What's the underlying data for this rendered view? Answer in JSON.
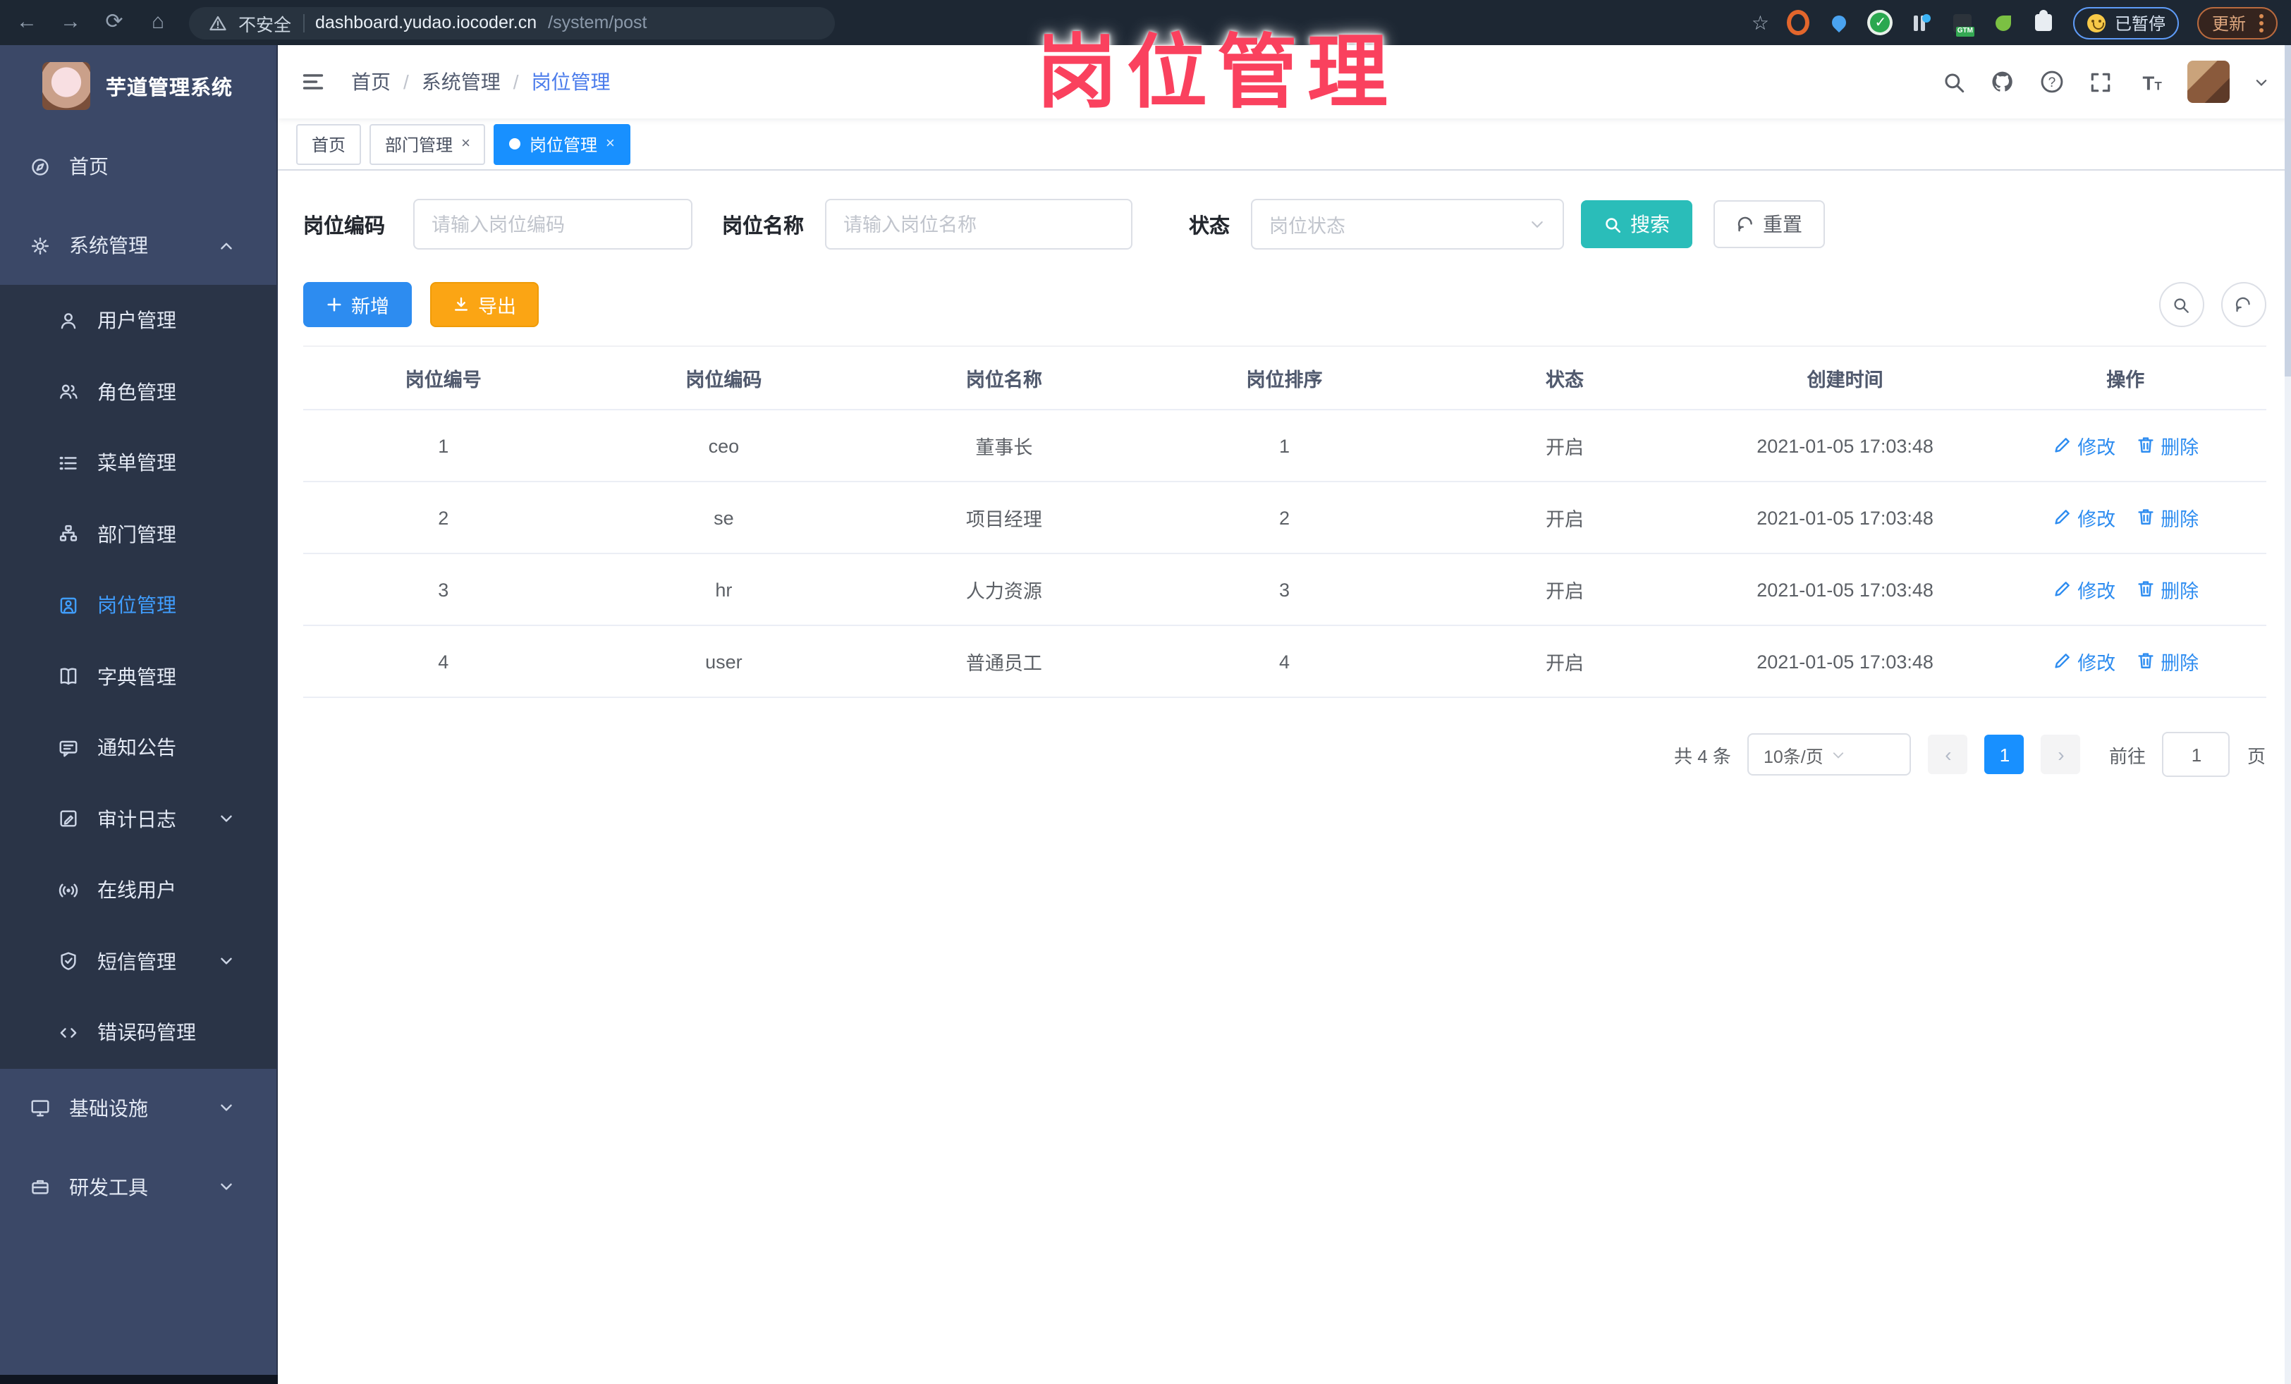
{
  "overlay": {
    "title": "岗位管理"
  },
  "browser": {
    "security_label": "不安全",
    "url_host": "dashboard.yudao.iocoder.cn",
    "url_path": "/system/post",
    "paused_label": "已暂停",
    "update_label": "更新"
  },
  "sidebar": {
    "logo_title": "芋道管理系统",
    "sections": [
      {
        "type": "item",
        "key": "home",
        "label": "首页",
        "icon": "compass"
      },
      {
        "type": "group",
        "key": "system-management",
        "label": "系统管理",
        "icon": "gear",
        "chevron": "up",
        "children": [
          {
            "key": "user-management",
            "label": "用户管理",
            "icon": "user"
          },
          {
            "key": "role-management",
            "label": "角色管理",
            "icon": "users"
          },
          {
            "key": "menu-management",
            "label": "菜单管理",
            "icon": "menulist"
          },
          {
            "key": "dept-management",
            "label": "部门管理",
            "icon": "orgtree"
          },
          {
            "key": "post-management",
            "label": "岗位管理",
            "icon": "badge",
            "active": true
          },
          {
            "key": "dict-management",
            "label": "字典管理",
            "icon": "book"
          },
          {
            "key": "notice",
            "label": "通知公告",
            "icon": "message"
          },
          {
            "key": "audit-log",
            "label": "审计日志",
            "icon": "log",
            "chevron": "down"
          },
          {
            "key": "online-user",
            "label": "在线用户",
            "icon": "broadcast"
          },
          {
            "key": "sms-management",
            "label": "短信管理",
            "icon": "shield",
            "chevron": "down"
          },
          {
            "key": "error-code",
            "label": "错误码管理",
            "icon": "code"
          }
        ]
      },
      {
        "type": "item",
        "key": "infrastructure",
        "label": "基础设施",
        "icon": "monitor",
        "chevron": "down"
      },
      {
        "type": "item",
        "key": "dev-tools",
        "label": "研发工具",
        "icon": "toolbox",
        "chevron": "down"
      }
    ]
  },
  "navbar": {
    "breadcrumb": [
      "首页",
      "系统管理",
      "岗位管理"
    ]
  },
  "tabs": [
    {
      "label": "首页",
      "closable": false,
      "active": false
    },
    {
      "label": "部门管理",
      "closable": true,
      "active": false
    },
    {
      "label": "岗位管理",
      "closable": true,
      "active": true
    }
  ],
  "filters": {
    "code_label": "岗位编码",
    "code_placeholder": "请输入岗位编码",
    "name_label": "岗位名称",
    "name_placeholder": "请输入岗位名称",
    "status_label": "状态",
    "status_placeholder": "岗位状态",
    "search_label": "搜索",
    "reset_label": "重置"
  },
  "toolbar": {
    "add_label": "新增",
    "export_label": "导出"
  },
  "table": {
    "columns": [
      "岗位编号",
      "岗位编码",
      "岗位名称",
      "岗位排序",
      "状态",
      "创建时间",
      "操作"
    ],
    "edit_label": "修改",
    "delete_label": "删除",
    "rows": [
      {
        "id": "1",
        "code": "ceo",
        "name": "董事长",
        "sort": "1",
        "status": "开启",
        "created": "2021-01-05 17:03:48"
      },
      {
        "id": "2",
        "code": "se",
        "name": "项目经理",
        "sort": "2",
        "status": "开启",
        "created": "2021-01-05 17:03:48"
      },
      {
        "id": "3",
        "code": "hr",
        "name": "人力资源",
        "sort": "3",
        "status": "开启",
        "created": "2021-01-05 17:03:48"
      },
      {
        "id": "4",
        "code": "user",
        "name": "普通员工",
        "sort": "4",
        "status": "开启",
        "created": "2021-01-05 17:03:48"
      }
    ]
  },
  "pagination": {
    "total_text": "共 4 条",
    "page_size": "10条/页",
    "current_page": "1",
    "goto_label": "前往",
    "goto_value": "1",
    "page_unit": "页"
  },
  "colors": {
    "accent_blue": "#2d8cf0",
    "tab_active_blue": "#1890ff",
    "sidebar_active_blue": "#409eff",
    "search_teal": "#2abdb9",
    "export_orange": "#fba514",
    "overlay_pink": "#fa415e",
    "sidebar_bg": "#3b4867",
    "submenu_bg": "#2a3447"
  }
}
